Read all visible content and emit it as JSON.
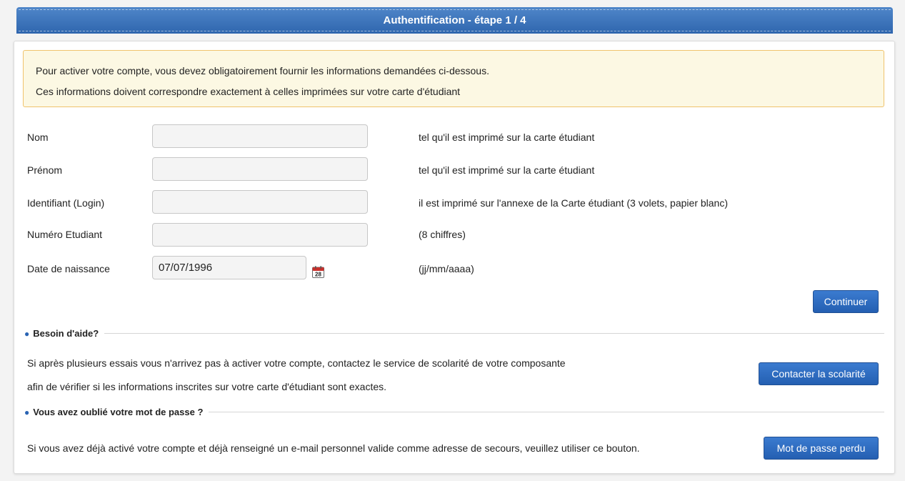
{
  "header": {
    "title": "Authentification - étape 1 / 4"
  },
  "notice": {
    "line1": "Pour activer votre compte, vous devez obligatoirement fournir les informations demandées ci-dessous.",
    "line2": "Ces informations doivent correspondre exactement à celles imprimées sur votre carte d'étudiant"
  },
  "form": {
    "nom": {
      "label": "Nom",
      "value": "",
      "hint": "tel qu'il est imprimé sur la carte étudiant"
    },
    "prenom": {
      "label": "Prénom",
      "value": "",
      "hint": "tel qu'il est imprimé sur la carte étudiant"
    },
    "login": {
      "label": "Identifiant (Login)",
      "value": "",
      "hint": "il est imprimé sur l'annexe de la Carte étudiant (3 volets, papier blanc)"
    },
    "numero": {
      "label": "Numéro Etudiant",
      "value": "",
      "hint": "(8 chiffres)"
    },
    "naissance": {
      "label": "Date de naissance",
      "value": "07/07/1996",
      "hint": "(jj/mm/aaaa)",
      "calendar_day": "28"
    },
    "submit_label": "Continuer"
  },
  "help": {
    "title": "Besoin d'aide?",
    "text1": "Si après plusieurs essais vous n'arrivez pas à activer votre compte, contactez le service de scolarité de votre composante",
    "text2": "afin de vérifier si les informations inscrites sur votre carte d'étudiant sont exactes.",
    "button_label": "Contacter la scolarité"
  },
  "forgot": {
    "title": "Vous avez oublié votre mot de passe ?",
    "text": "Si vous avez déjà activé votre compte et déjà renseigné un e-mail personnel valide comme adresse de secours, veuillez utiliser ce bouton.",
    "button_label": "Mot de passe perdu"
  },
  "colors": {
    "header": "#2f66ae",
    "button": "#2a68bd",
    "notice_bg": "#fcf8e3",
    "notice_border": "#f0c36d"
  },
  "icons": {
    "calendar": "calendar-icon",
    "bullet": "bullet-icon"
  }
}
